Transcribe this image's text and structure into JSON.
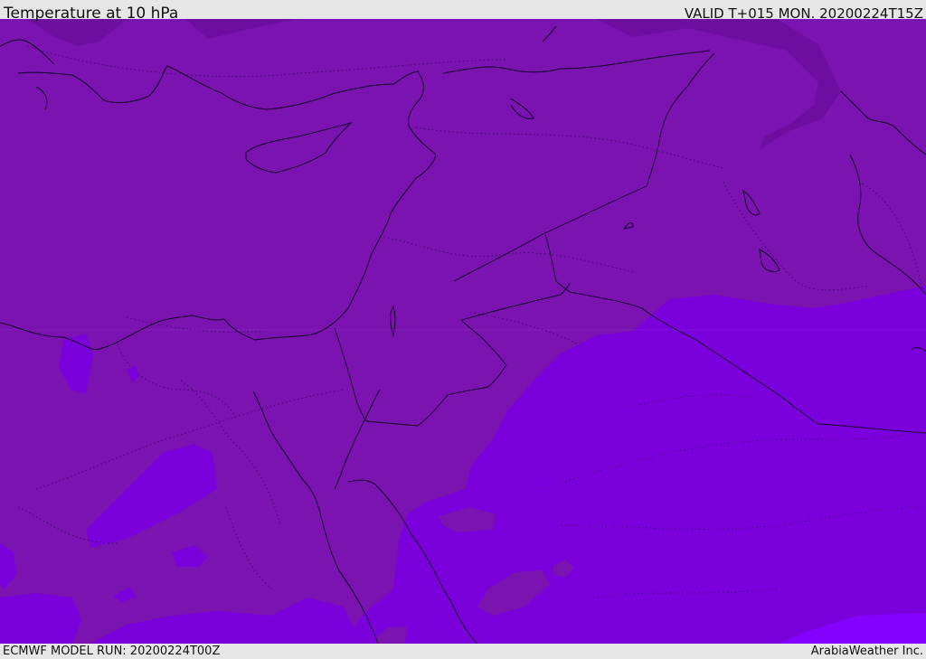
{
  "header": {
    "title": "Temperature at 10 hPa",
    "valid": "VALID T+015 MON. 20200224T15Z"
  },
  "footer": {
    "model_run": "ECMWF MODEL RUN: 20200224T00Z",
    "credit": "ArabiaWeather Inc."
  },
  "colors": {
    "band_warm": "#7b13b0",
    "band_cool": "#7a00dc",
    "band_bright": "#8500ff",
    "band_dark": "#6e0ea0",
    "coast": "#13002a",
    "background": "#e6e6e6"
  }
}
